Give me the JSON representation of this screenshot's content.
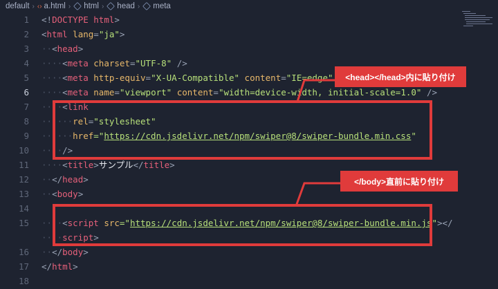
{
  "breadcrumb": {
    "items": [
      "default",
      "a.html",
      "html",
      "head",
      "meta"
    ]
  },
  "line_numbers": [
    "1",
    "2",
    "3",
    "4",
    "5",
    "6",
    "7",
    "8",
    "9",
    "10",
    "11",
    "12",
    "13",
    "14",
    "15",
    "16",
    "17",
    "18"
  ],
  "active_line": "6",
  "code": {
    "l1": {
      "a": "<!",
      "b": "DOCTYPE",
      "c": " html",
      "d": ">"
    },
    "l2": {
      "a": "<",
      "b": "html",
      "c": " lang",
      "d": "=",
      "e": "\"ja\"",
      "f": ">"
    },
    "l3": {
      "dots": "··",
      "a": "<",
      "b": "head",
      "c": ">"
    },
    "l4": {
      "dots": "····",
      "a": "<",
      "b": "meta",
      "c": " charset",
      "d": "=",
      "e": "\"UTF-8\"",
      "f": " />"
    },
    "l5": {
      "dots": "····",
      "a": "<",
      "b": "meta",
      "c": " http-equiv",
      "d": "=",
      "e": "\"X-UA-Compatible\"",
      "f": " content",
      "g": "=",
      "h": "\"IE=edge\"",
      "i": " />"
    },
    "l6": {
      "dots": "····",
      "a": "<",
      "b": "meta",
      "c": " name",
      "d": "=",
      "e": "\"viewport\"",
      "f": " content",
      "g": "=",
      "h": "\"width=device-width, initial-scale=1.0\"",
      "i": " />"
    },
    "l7": {
      "dots": "····",
      "a": "<",
      "b": "link"
    },
    "l8": {
      "dots": "······",
      "c": "rel",
      "d": "=",
      "e": "\"stylesheet\""
    },
    "l9": {
      "dots": "······",
      "c": "href",
      "d": "=\"",
      "e": "https://cdn.jsdelivr.net/npm/swiper@8/swiper-bundle.min.css",
      "f": "\""
    },
    "l10": {
      "dots": "····",
      "a": "/>"
    },
    "l11": {
      "dots": "····",
      "a": "<",
      "b": "title",
      "c": ">",
      "text": "サンプル",
      "d": "</",
      "e": "title",
      "f": ">"
    },
    "l12": {
      "dots": "··",
      "a": "</",
      "b": "head",
      "c": ">"
    },
    "l13": {
      "dots": "··",
      "a": "<",
      "b": "body",
      "c": ">"
    },
    "l14": {
      "dots": ""
    },
    "l15": {
      "dots": "····",
      "a": "<",
      "b": "script",
      "c": " src",
      "d": "=\"",
      "e": "https://cdn.jsdelivr.net/npm/swiper@8/swiper-bundle.min.js",
      "f": "\"",
      "g": "></"
    },
    "l15b": {
      "dots": "····",
      "a": "script",
      "b": ">"
    },
    "l16": {
      "dots": "··",
      "a": "</",
      "b": "body",
      "c": ">"
    },
    "l17": {
      "a": "</",
      "b": "html",
      "c": ">"
    }
  },
  "callouts": {
    "head": "<head></head>内に貼り付け",
    "body": "</body>直前に貼り付け"
  },
  "colors": {
    "highlight": "#e03b3b",
    "background": "#1e2330"
  }
}
